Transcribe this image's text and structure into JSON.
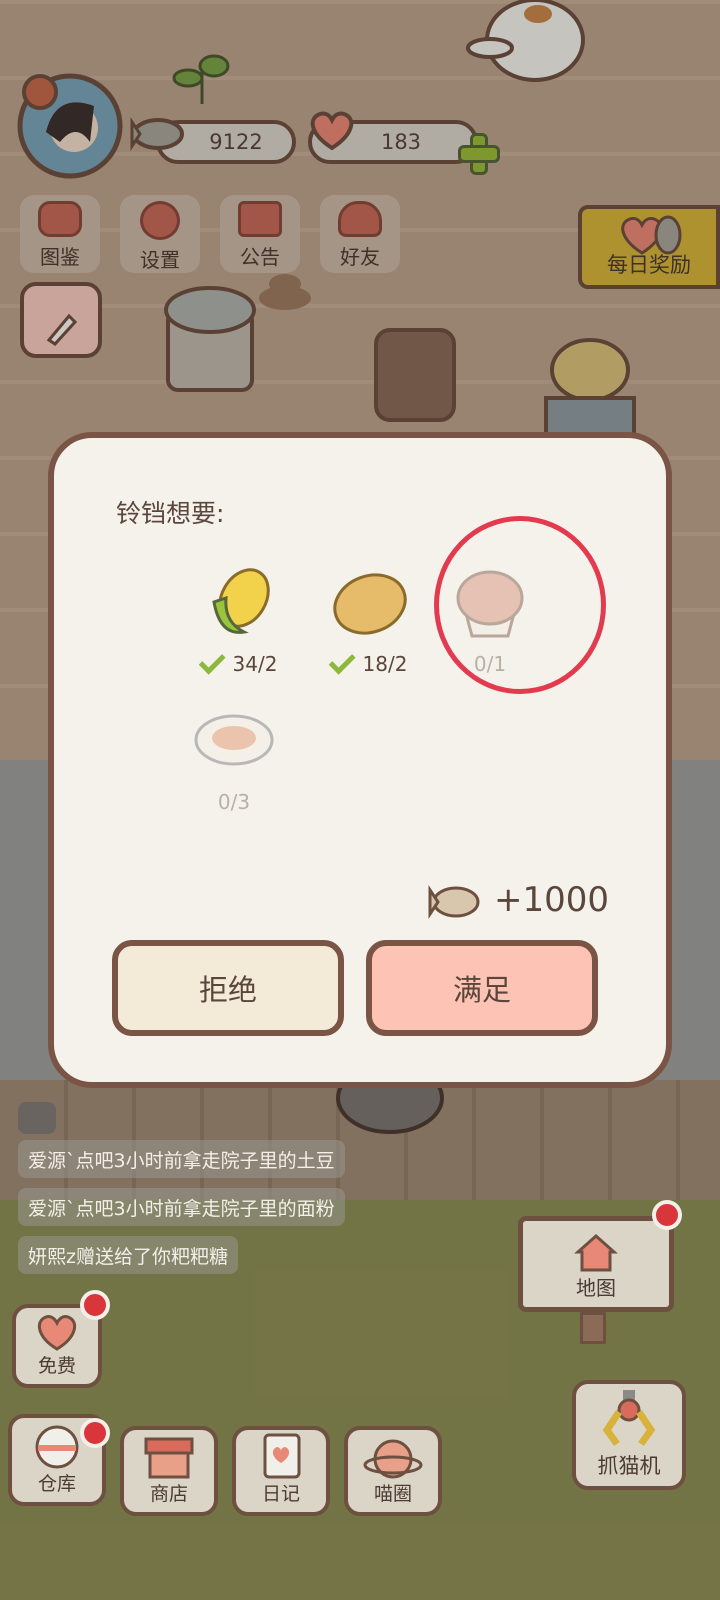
{
  "currency": {
    "fish": "9122",
    "hearts": "183"
  },
  "top_menu": [
    {
      "label": "图鉴"
    },
    {
      "label": "设置"
    },
    {
      "label": "公告"
    },
    {
      "label": "好友"
    }
  ],
  "daily_reward": {
    "label": "每日奖励"
  },
  "dialog": {
    "title": "铃铛想要:",
    "items": [
      {
        "name": "corn",
        "count": "34/2",
        "satisfied": true
      },
      {
        "name": "potato",
        "count": "18/2",
        "satisfied": true
      },
      {
        "name": "muffin",
        "count": "0/1",
        "satisfied": false
      },
      {
        "name": "noodles",
        "count": "0/3",
        "satisfied": false
      }
    ],
    "reward": "+1000",
    "reject_label": "拒绝",
    "accept_label": "满足"
  },
  "messages": [
    "爱源`点吧3小时前拿走院子里的土豆",
    "爱源`点吧3小时前拿走院子里的面粉",
    "妍熙z赠送给了你粑粑糖"
  ],
  "map": {
    "label": "地图"
  },
  "bottom_nav": {
    "free": "免费",
    "warehouse": "仓库",
    "shop": "商店",
    "diary": "日记",
    "meow_circle": "喵圈",
    "claw_machine": "抓猫机"
  },
  "colors": {
    "accent_red": "#e23a4e",
    "badge_red": "#d8363b",
    "accept_bg": "#fdc3b5"
  }
}
